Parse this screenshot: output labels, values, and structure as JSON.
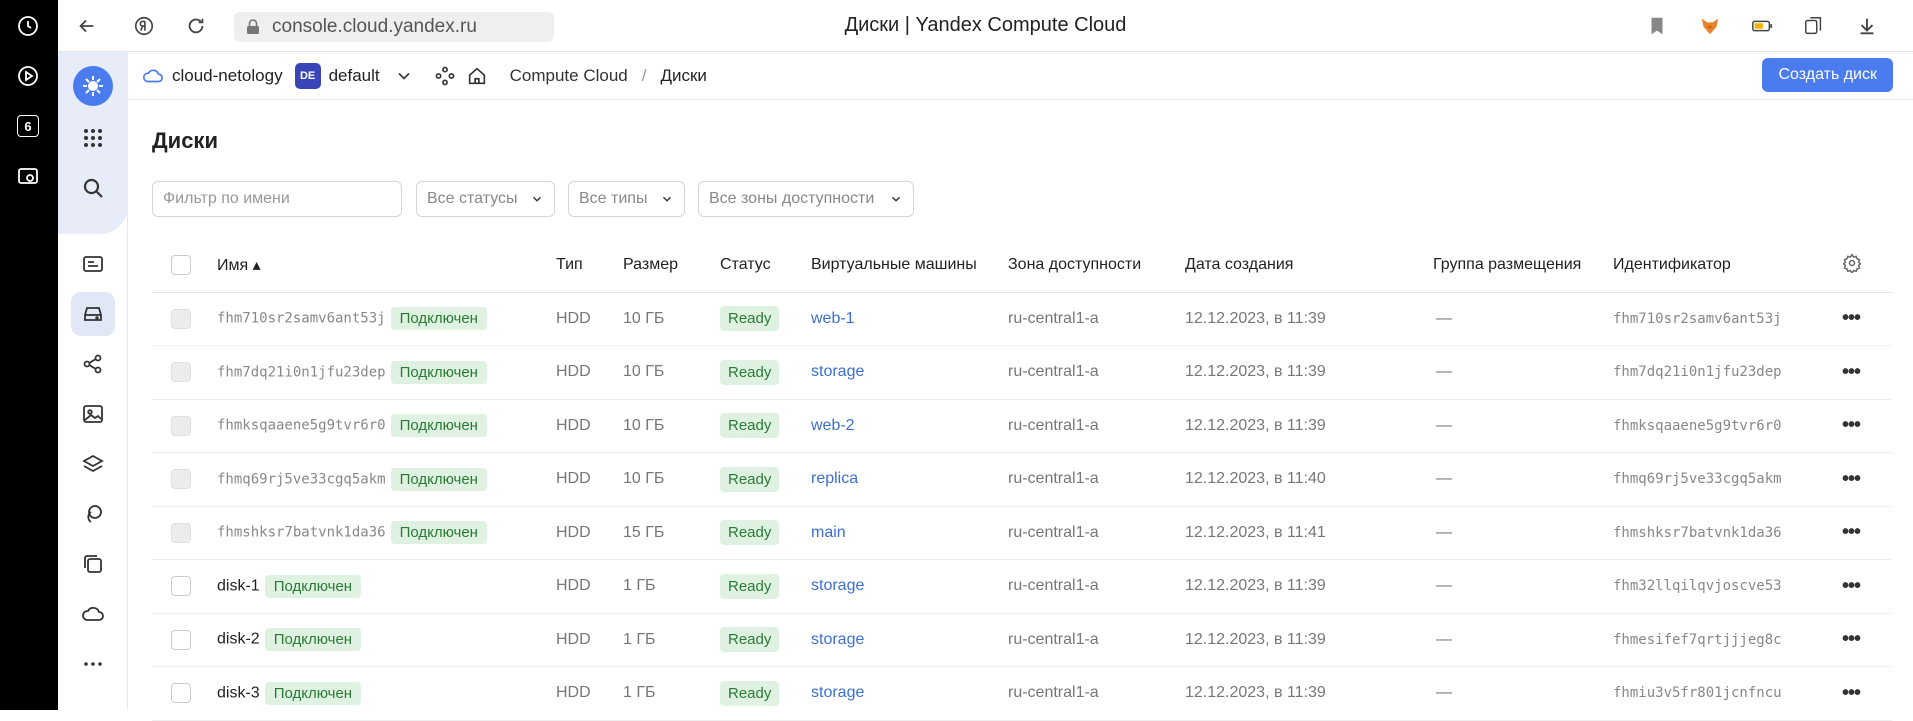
{
  "os_sidebar": {
    "icons": [
      "clock-icon",
      "play-circle-icon",
      "number-badge-icon",
      "camera-icon"
    ],
    "badge_number": "6"
  },
  "browser": {
    "url": "console.cloud.yandex.ru",
    "title": "Диски | Yandex Compute Cloud"
  },
  "header": {
    "cloud": "cloud-netology",
    "folder_badge": "DE",
    "folder": "default",
    "breadcrumb_service": "Compute Cloud",
    "breadcrumb_separator": "/",
    "breadcrumb_page": "Диски",
    "create_button": "Создать диск"
  },
  "page": {
    "title": "Диски",
    "filters": {
      "name_placeholder": "Фильтр по имени",
      "status": "Все статусы",
      "type": "Все типы",
      "zone": "Все зоны доступности"
    },
    "columns": {
      "name": "Имя ▴",
      "type": "Тип",
      "size": "Размер",
      "status": "Статус",
      "vms": "Виртуальные машины",
      "zone": "Зона доступности",
      "created": "Дата создания",
      "placement": "Группа размещения",
      "id": "Идентификатор"
    },
    "rows": [
      {
        "name": "fhm710sr2samv6ant53j",
        "mono": true,
        "tag": "Подключен",
        "type": "HDD",
        "size": "10 ГБ",
        "status": "Ready",
        "vm": "web-1",
        "zone": "ru-central1-a",
        "created": "12.12.2023, в 11:39",
        "placement": "—",
        "id": "fhm710sr2samv6ant53j",
        "disabled": true
      },
      {
        "name": "fhm7dq21i0n1jfu23dep",
        "mono": true,
        "tag": "Подключен",
        "type": "HDD",
        "size": "10 ГБ",
        "status": "Ready",
        "vm": "storage",
        "zone": "ru-central1-a",
        "created": "12.12.2023, в 11:39",
        "placement": "—",
        "id": "fhm7dq21i0n1jfu23dep",
        "disabled": true
      },
      {
        "name": "fhmksqaaene5g9tvr6r0",
        "mono": true,
        "tag": "Подключен",
        "type": "HDD",
        "size": "10 ГБ",
        "status": "Ready",
        "vm": "web-2",
        "zone": "ru-central1-a",
        "created": "12.12.2023, в 11:39",
        "placement": "—",
        "id": "fhmksqaaene5g9tvr6r0",
        "disabled": true
      },
      {
        "name": "fhmq69rj5ve33cgq5akm",
        "mono": true,
        "tag": "Подключен",
        "type": "HDD",
        "size": "10 ГБ",
        "status": "Ready",
        "vm": "replica",
        "zone": "ru-central1-a",
        "created": "12.12.2023, в 11:40",
        "placement": "—",
        "id": "fhmq69rj5ve33cgq5akm",
        "disabled": true
      },
      {
        "name": "fhmshksr7batvnk1da36",
        "mono": true,
        "tag": "Подключен",
        "type": "HDD",
        "size": "15 ГБ",
        "status": "Ready",
        "vm": "main",
        "zone": "ru-central1-a",
        "created": "12.12.2023, в 11:41",
        "placement": "—",
        "id": "fhmshksr7batvnk1da36",
        "disabled": true
      },
      {
        "name": "disk-1",
        "mono": false,
        "tag": "Подключен",
        "type": "HDD",
        "size": "1 ГБ",
        "status": "Ready",
        "vm": "storage",
        "zone": "ru-central1-a",
        "created": "12.12.2023, в 11:39",
        "placement": "—",
        "id": "fhm32llqilqvjoscve53",
        "disabled": false
      },
      {
        "name": "disk-2",
        "mono": false,
        "tag": "Подключен",
        "type": "HDD",
        "size": "1 ГБ",
        "status": "Ready",
        "vm": "storage",
        "zone": "ru-central1-a",
        "created": "12.12.2023, в 11:39",
        "placement": "—",
        "id": "fhmesifef7qrtjjjeg8c",
        "disabled": false
      },
      {
        "name": "disk-3",
        "mono": false,
        "tag": "Подключен",
        "type": "HDD",
        "size": "1 ГБ",
        "status": "Ready",
        "vm": "storage",
        "zone": "ru-central1-a",
        "created": "12.12.2023, в 11:39",
        "placement": "—",
        "id": "fhmiu3v5fr801jcnfncu",
        "disabled": false
      }
    ],
    "row_menu": "•••"
  },
  "colors": {
    "accent": "#4a7cf0",
    "ready_bg": "#dff2e1",
    "ready_text": "#2a7a36",
    "link": "#3b6fd1"
  }
}
